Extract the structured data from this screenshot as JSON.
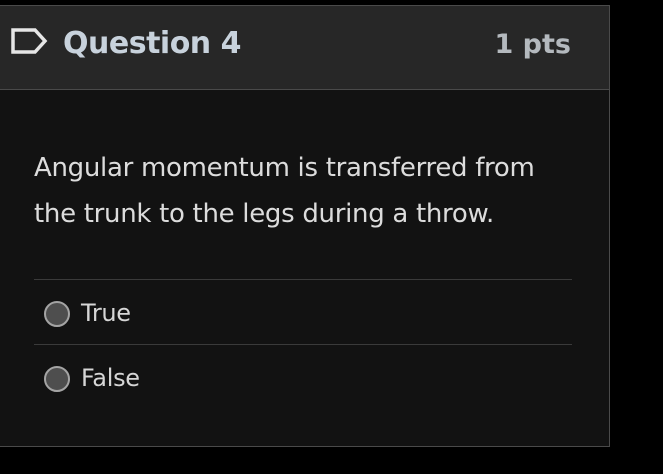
{
  "question": {
    "title": "Question 4",
    "points": "1 pts",
    "flag_icon": "flag-icon",
    "text": "Angular momentum is transferred from the trunk to the legs during a throw."
  },
  "answers": [
    {
      "label": "True",
      "selected": false
    },
    {
      "label": "False",
      "selected": false
    }
  ],
  "colors": {
    "page_background": "#000000",
    "card_background": "#121212",
    "header_background": "#272727",
    "title_text": "#c8d2dc",
    "body_text": "#dcdcdc"
  }
}
